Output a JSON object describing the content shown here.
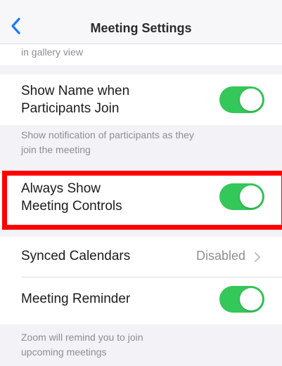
{
  "navbar": {
    "title": "Meeting Settings",
    "back_icon": "chevron-left-icon"
  },
  "partial_note": "in gallery view",
  "show_name": {
    "label_line1": "Show Name when",
    "label_line2": "Participants Join",
    "toggle_on": true,
    "note_line1": "Show notification of participants as they",
    "note_line2": "join the meeting"
  },
  "always_show": {
    "label_line1": "Always Show",
    "label_line2": "Meeting Controls",
    "toggle_on": true
  },
  "synced_calendars": {
    "label": "Synced Calendars",
    "value": "Disabled",
    "chevron_icon": "chevron-right-icon"
  },
  "meeting_reminder": {
    "label": "Meeting Reminder",
    "toggle_on": true,
    "note_line1": "Zoom will remind you to join",
    "note_line2": "upcoming meetings"
  },
  "colors": {
    "accent_blue": "#1a7cf5",
    "toggle_green": "#34c759",
    "highlight_red": "#ff0000"
  }
}
